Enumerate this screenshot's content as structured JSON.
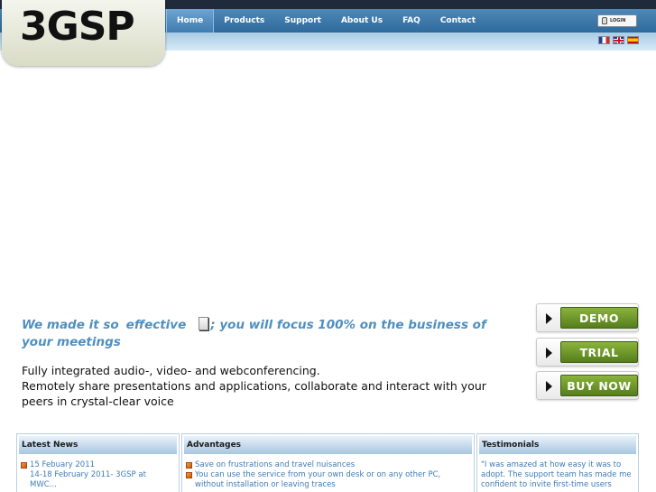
{
  "header": {
    "logo_text": "3GSP",
    "nav": [
      {
        "label": "Home",
        "active": true
      },
      {
        "label": "Products",
        "active": false
      },
      {
        "label": "Support",
        "active": false
      },
      {
        "label": "About Us",
        "active": false
      },
      {
        "label": "FAQ",
        "active": false
      },
      {
        "label": "Contact",
        "active": false
      }
    ],
    "login_label": "LOGIN",
    "languages": [
      "French",
      "English",
      "Spanish"
    ]
  },
  "hero": {
    "tagline_part1": "We made it so",
    "tagline_part2": "effective",
    "tagline_part3": "; you will focus 100% on the business of your meetings",
    "desc_lines": [
      "Fully integrated audio-, video- and webconferencing.",
      "Remotely share presentations and applications, collaborate and interact with your peers in crystal-clear voice"
    ]
  },
  "actions": [
    {
      "label": "DEMO"
    },
    {
      "label": "TRIAL"
    },
    {
      "label": "BUY NOW"
    }
  ],
  "boxes": {
    "news": {
      "title": "Latest News",
      "date": "15 Febuary 2011",
      "text": "14-18 February 2011- 3GSP at MWC..."
    },
    "advantages": {
      "title": "Advantages",
      "items": [
        "Save on frustrations and travel nuisances",
        "You can use the service from your own desk or on any other PC, without installation or leaving traces"
      ]
    },
    "testimonials": {
      "title": "Testimonials",
      "text": "\"I was amazed at how easy it was to adopt. The support team has made me confident to invite first-time users"
    }
  },
  "colors": {
    "nav_bar": "#2f6a9c",
    "tagline": "#4f8fc0",
    "button_green": "#6c9a2a",
    "link_blue": "#3d7cb8"
  }
}
